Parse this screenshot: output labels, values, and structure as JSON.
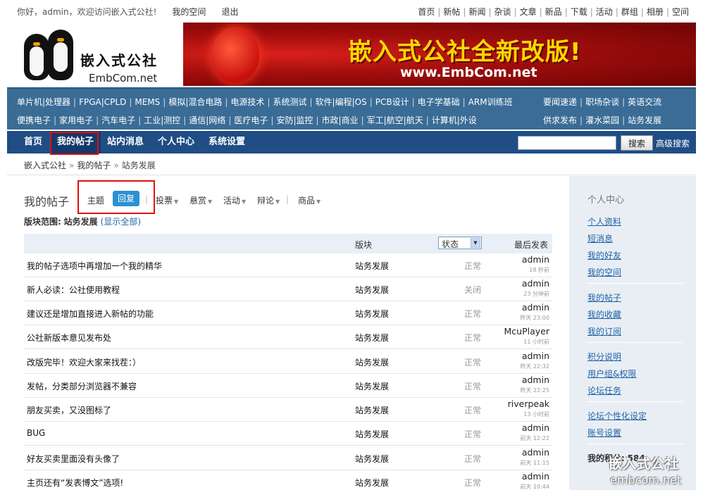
{
  "topbar": {
    "greeting": "你好，admin，欢迎访问嵌入式公社!",
    "my_space": "我的空间",
    "logout": "退出",
    "links": [
      "首页",
      "新帖",
      "新闻",
      "杂谈",
      "文章",
      "新品",
      "下载",
      "活动",
      "群组",
      "相册",
      "空间"
    ]
  },
  "logo": {
    "cn": "嵌入式公社",
    "en": "EmbCom.net"
  },
  "banner": {
    "title": "嵌入式公社全新改版!",
    "url": "www.EmbCom.net"
  },
  "categories": {
    "row1": [
      "单片机|处理器",
      "FPGA|CPLD",
      "MEMS",
      "模拟|混合电路",
      "电源技术",
      "系统测试",
      "软件|编程|OS",
      "PCB设计",
      "电子学基础",
      "ARM训练班"
    ],
    "row2": [
      "便携电子",
      "家用电子",
      "汽车电子",
      "工业|测控",
      "通信|网络",
      "医疗电子",
      "安防|监控",
      "市政|商业",
      "军工|航空|航天",
      "计算机|外设"
    ],
    "right1": [
      "要闻速递",
      "职场杂谈",
      "英语交流"
    ],
    "right2": [
      "供求发布",
      "灌水菜园",
      "站务发展"
    ]
  },
  "mainnav": {
    "items": [
      "首页",
      "我的帖子",
      "站内消息",
      "个人中心",
      "系统设置"
    ],
    "search_button": "搜索",
    "advanced_search": "高级搜索"
  },
  "breadcrumb": [
    "嵌入式公社",
    "我的帖子",
    "站务发展"
  ],
  "content": {
    "title": "我的帖子",
    "tabs": {
      "topic": "主题",
      "reply": "回复",
      "poll": "投票",
      "reward": "悬赏",
      "activity": "活动",
      "debate": "辩论",
      "goods": "商品"
    },
    "range_label": "版块范围:",
    "range_value": "站务发展",
    "show_all": "(显示全部)",
    "columns": {
      "forum": "版块",
      "status": "状态",
      "last_post": "最后发表"
    },
    "rows": [
      {
        "subject": "我的帖子选项中再增加一个我的精华",
        "forum": "站务发展",
        "status": "正常",
        "user": "admin",
        "time": "18 秒前"
      },
      {
        "subject": "新人必读：公社使用教程",
        "forum": "站务发展",
        "status": "关闭",
        "user": "admin",
        "time": "23 分钟前"
      },
      {
        "subject": "建议还是增加直接进入新帖的功能",
        "forum": "站务发展",
        "status": "正常",
        "user": "admin",
        "time": "昨天 23:00"
      },
      {
        "subject": "公社新版本意见发布处",
        "forum": "站务发展",
        "status": "正常",
        "user": "McuPlayer",
        "time": "11 小时前"
      },
      {
        "subject": "改版完毕！欢迎大家来找茬：）",
        "forum": "站务发展",
        "status": "正常",
        "user": "admin",
        "time": "昨天 22:32"
      },
      {
        "subject": "发帖，分类部分浏览器不兼容",
        "forum": "站务发展",
        "status": "正常",
        "user": "admin",
        "time": "昨天 22:25"
      },
      {
        "subject": "朋友买卖，又没图标了",
        "forum": "站务发展",
        "status": "正常",
        "user": "riverpeak",
        "time": "13 小时前"
      },
      {
        "subject": "BUG",
        "forum": "站务发展",
        "status": "正常",
        "user": "admin",
        "time": "前天 12:22"
      },
      {
        "subject": "好友买卖里面没有头像了",
        "forum": "站务发展",
        "status": "正常",
        "user": "admin",
        "time": "前天 11:15"
      },
      {
        "subject": "主页还有“发表博文”选项!",
        "forum": "站务发展",
        "status": "正常",
        "user": "admin",
        "time": "前天 10:44"
      }
    ]
  },
  "sidebar": {
    "title": "个人中心",
    "group1": [
      "个人资料",
      "短消息",
      "我的好友",
      "我的空间"
    ],
    "group2": [
      "我的帖子",
      "我的收藏",
      "我的订阅"
    ],
    "group3": [
      "积分说明",
      "用户组&权限",
      "论坛任务"
    ],
    "group4": [
      "论坛个性化设定",
      "账号设置"
    ],
    "points_label": "我的积分:",
    "points_value": "584"
  },
  "watermark": {
    "cn": "嵌入式公社",
    "en": "embcom.net"
  },
  "colors": {
    "nav": "#1f4d84",
    "catnav": "#3a6c96",
    "accent": "#2b91d1",
    "highlight": "#e01010"
  }
}
